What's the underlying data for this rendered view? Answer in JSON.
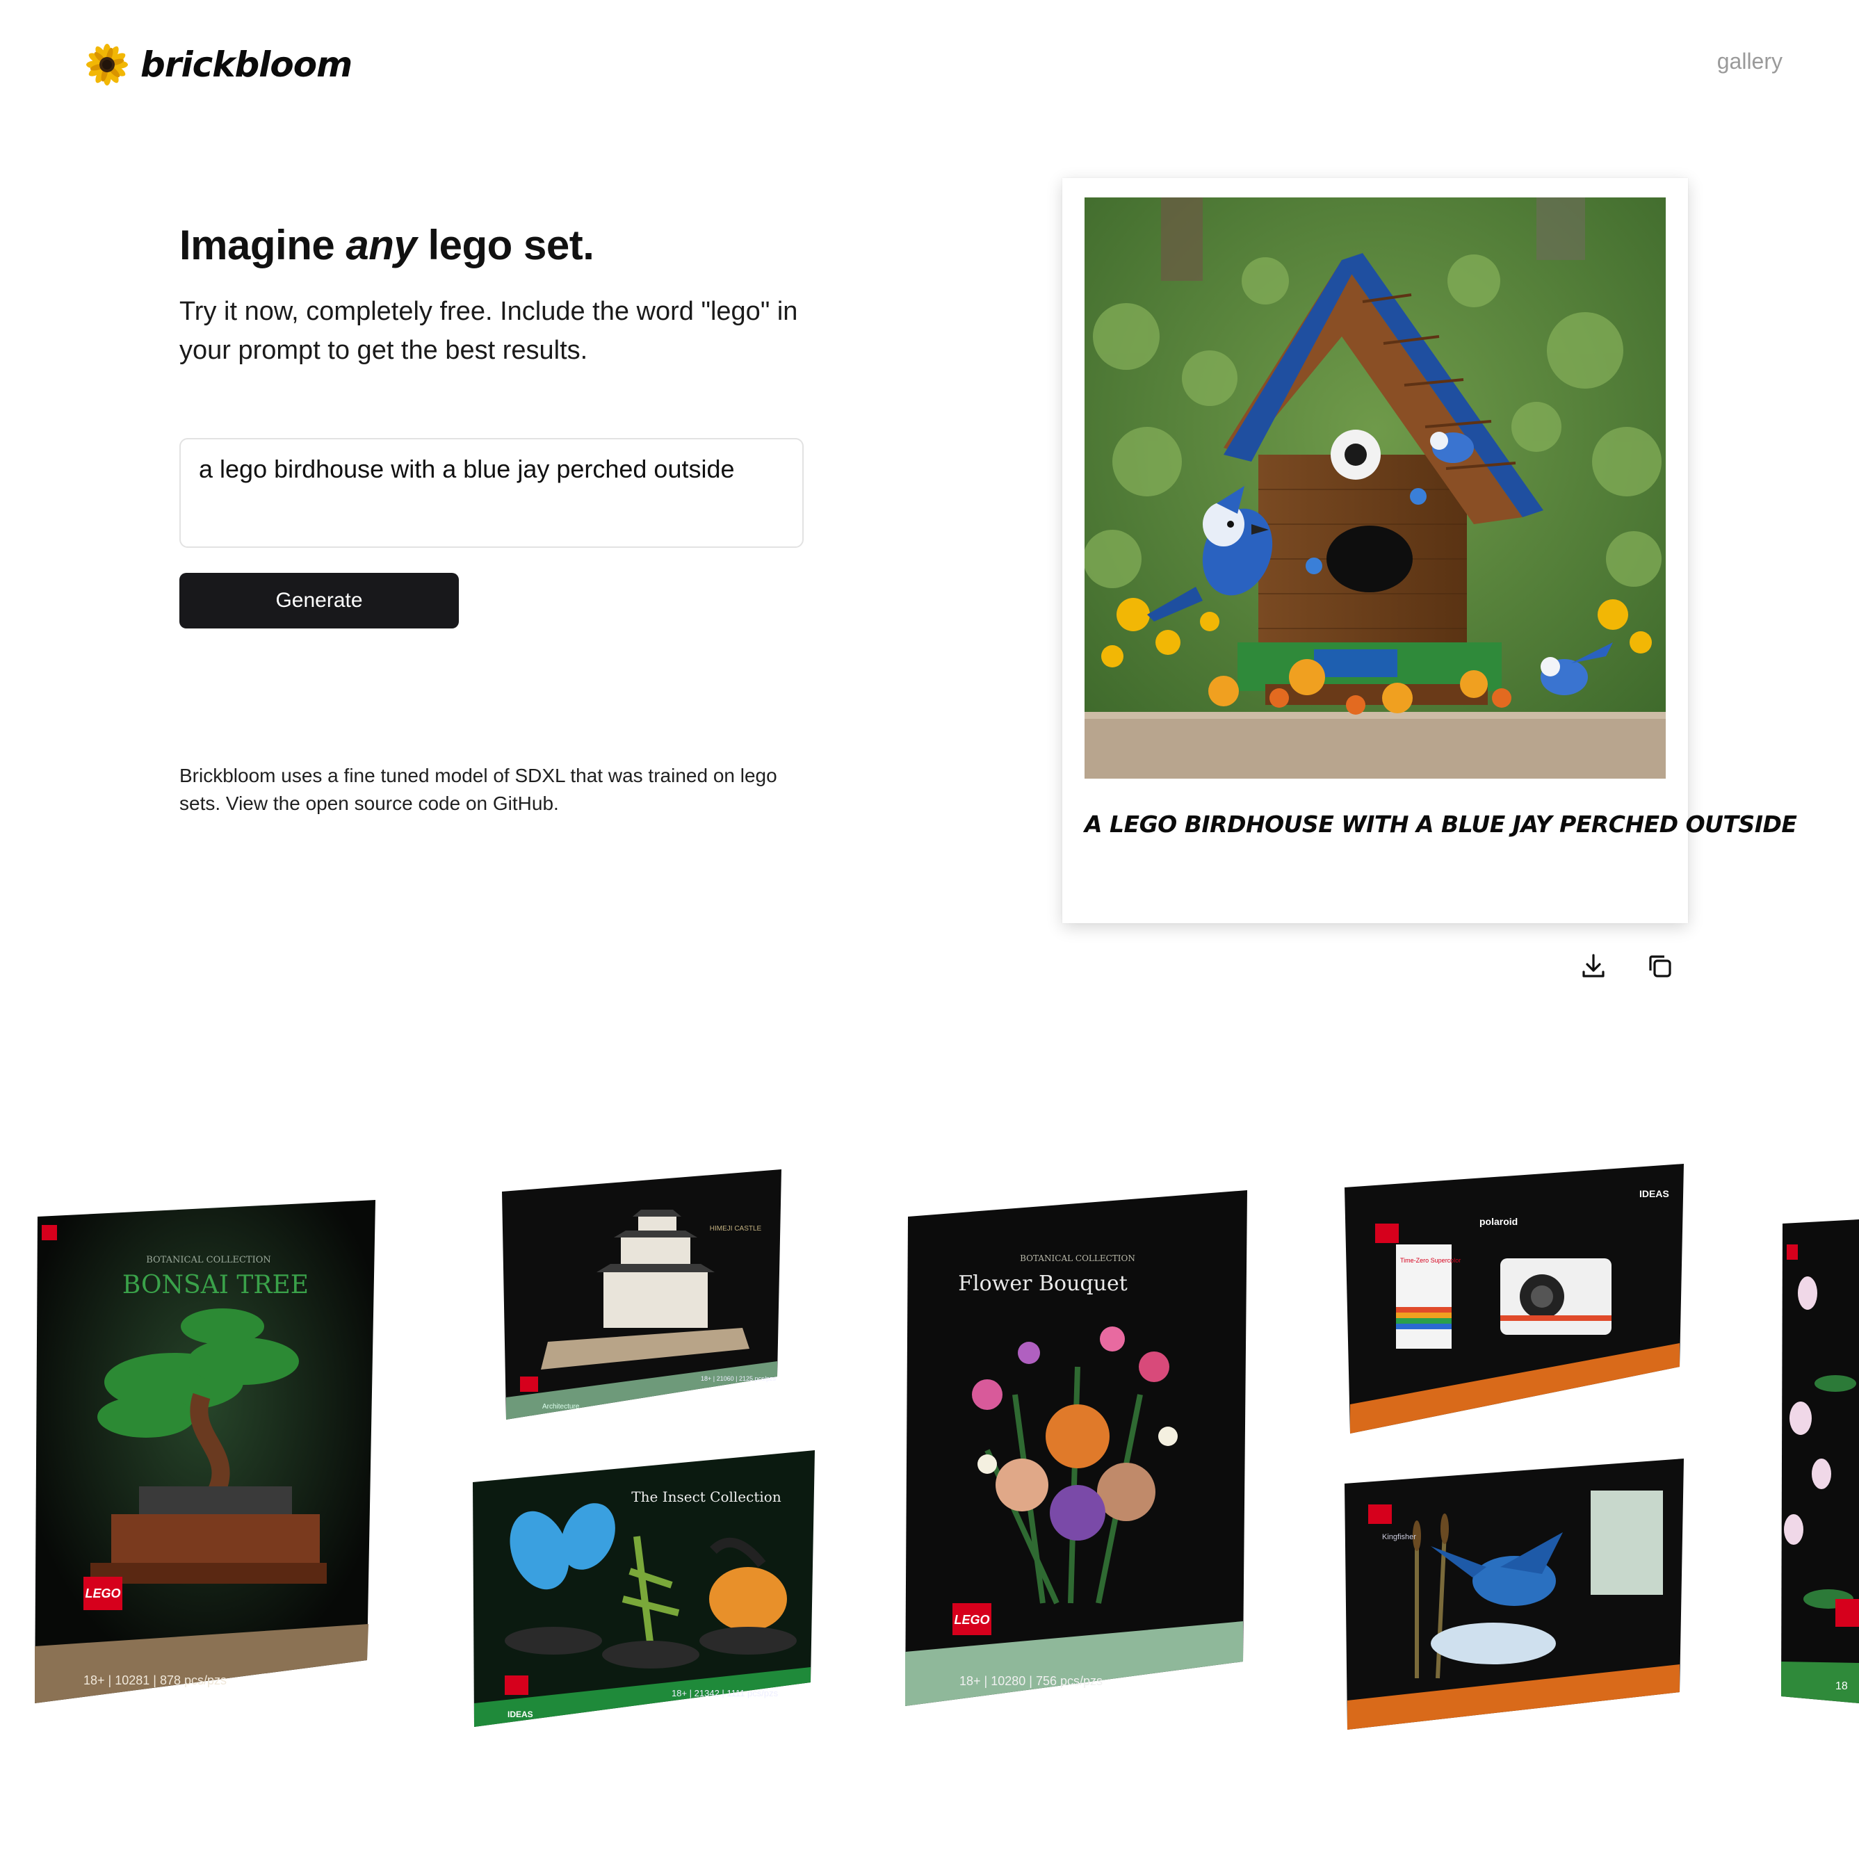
{
  "header": {
    "brand_name": "brickbloom",
    "nav_gallery": "gallery",
    "logo_icon": "sunflower-icon"
  },
  "hero": {
    "title_before": "Imagine ",
    "title_em": "any",
    "title_after": " lego set.",
    "subtitle": "Try it now, completely free. Include the word \"lego\" in your prompt to get the best results.",
    "prompt_value": "a lego birdhouse with a blue jay perched outside",
    "generate_label": "Generate",
    "footnote": "Brickbloom uses a fine tuned model of SDXL that was trained on lego sets. View the open source code on GitHub."
  },
  "result": {
    "caption": "A LEGO BIRDHOUSE WITH A BLUE JAY PERCHED OUTSIDE",
    "actions": [
      "download-icon",
      "copy-icon"
    ]
  },
  "gallery": {
    "bonsai": {
      "series": "BOTANICAL COLLECTION",
      "title": "BONSAI TREE",
      "info": "18+ | 10281 | 878 pcs/pzs"
    },
    "castle": {
      "title": "HIMEJI CASTLE",
      "theme": "Architecture",
      "info": "18+ | 21060 | 2125 pcs/pzs"
    },
    "insect": {
      "title": "The Insect Collection",
      "theme": "IDEAS",
      "info": "18+ | 21342 | 1111 pcs/pzs"
    },
    "bouquet": {
      "series": "BOTANICAL COLLECTION",
      "title": "Flower Bouquet",
      "info": "18+ | 10280 | 756 pcs/pzs"
    },
    "polaroid": {
      "brand": "polaroid",
      "theme": "IDEAS",
      "film": "Time-Zero Supercolor"
    },
    "kingfisher": {
      "title": "Kingfisher"
    },
    "orchid": {
      "info": "18"
    },
    "lego_logo": "LEGO"
  },
  "colors": {
    "button_bg": "#18181b",
    "nav_gray": "#9a9a9a",
    "box_black": "#0c0c0c",
    "lego_red": "#d6001c"
  }
}
